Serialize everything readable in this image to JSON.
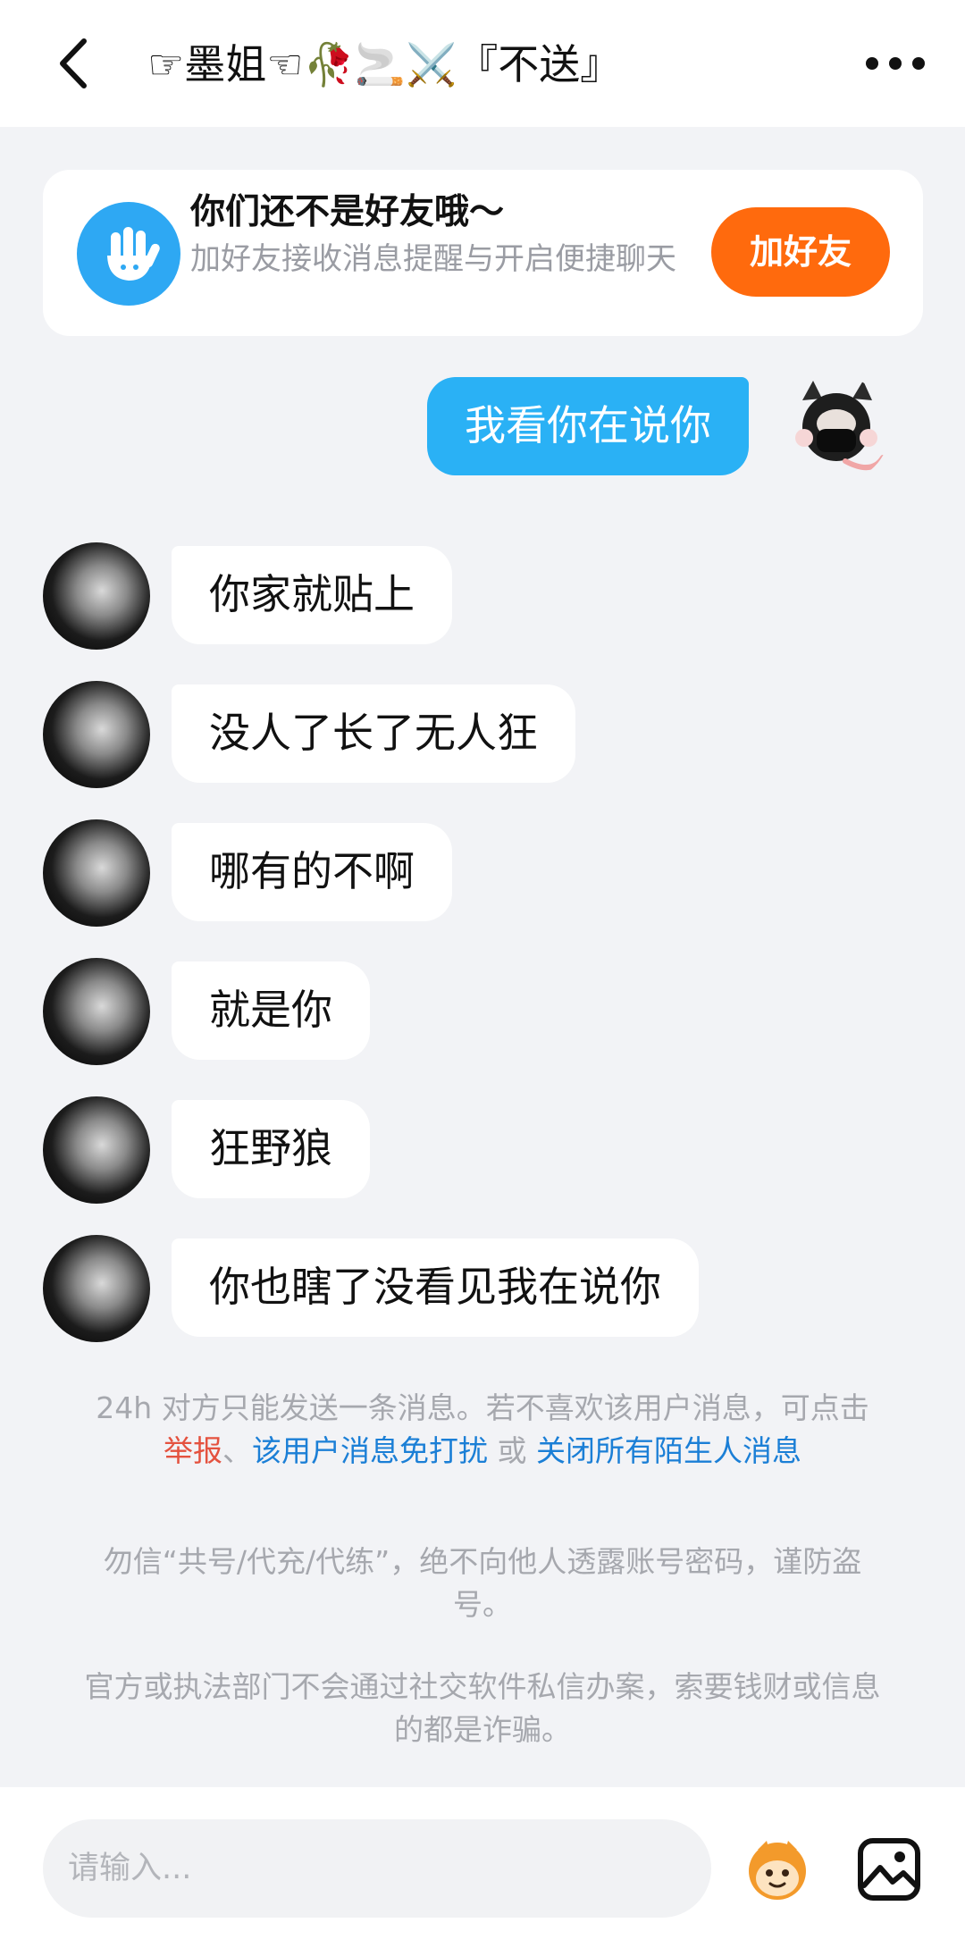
{
  "header": {
    "title": "☞墨姐☜🥀🚬⚔️『不送』"
  },
  "friend_banner": {
    "title": "你们还不是好友哦～",
    "subtitle": "加好友接收消息提醒与开启便捷聊天",
    "button": "加好友"
  },
  "messages": [
    {
      "from": "self",
      "text": "我看你在说你"
    },
    {
      "from": "other",
      "text": "你家就贴上"
    },
    {
      "from": "other",
      "text": "没人了长了无人狂"
    },
    {
      "from": "other",
      "text": "哪有的不啊"
    },
    {
      "from": "other",
      "text": "就是你"
    },
    {
      "from": "other",
      "text": "狂野狼"
    },
    {
      "from": "other",
      "text": "你也瞎了没看见我在说你"
    }
  ],
  "notice1": {
    "text_a": "24h 对方只能发送一条消息。若不喜欢该用户消息，可点击",
    "report": "举报",
    "sep1": "、",
    "mute": "该用户消息免打扰",
    "or": " 或 ",
    "close_all": "关闭所有陌生人消息"
  },
  "notice2": "勿信“共号/代充/代练”，绝不向他人透露账号密码，谨防盗号。",
  "notice3": "官方或执法部门不会通过社交软件私信办案，索要钱财或信息的都是诈骗。",
  "input": {
    "placeholder": "请输入..."
  },
  "colors": {
    "accent_blue": "#2ab1f5",
    "add_friend": "#ff6a0d",
    "link_red": "#e4523f",
    "link_blue": "#1b7fd6"
  }
}
